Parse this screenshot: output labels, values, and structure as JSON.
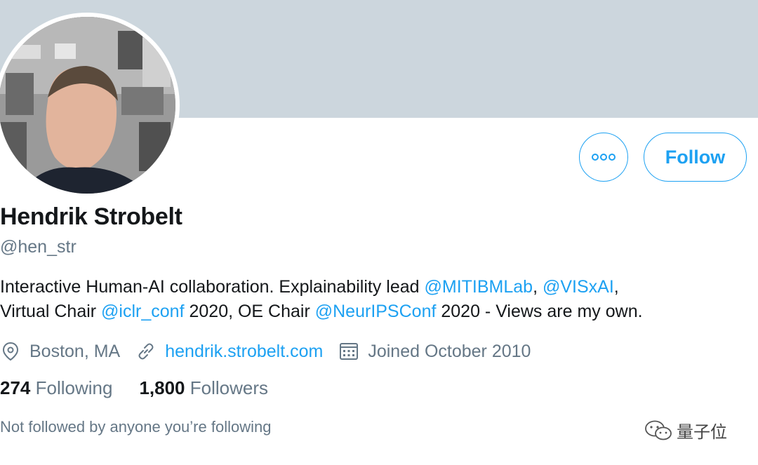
{
  "profile": {
    "name": "Hendrik Strobelt",
    "handle": "@hen_str",
    "bio": {
      "part1": "Interactive Human-AI collaboration. Explainability lead ",
      "mention1": "@MITIBMLab",
      "sep1": ", ",
      "mention2": "@VISxAI",
      "sep2": ",",
      "part2": "Virtual Chair ",
      "mention3": "@iclr_conf",
      "part3": " 2020, OE Chair ",
      "mention4": "@NeurIPSConf",
      "part4": " 2020 - Views are my own."
    },
    "location": "Boston, MA",
    "website": "hendrik.strobelt.com",
    "joined": "Joined October 2010",
    "following_count": "274",
    "following_label": "Following",
    "followers_count": "1,800",
    "followers_label": "Followers",
    "social_context": "Not followed by anyone you’re following"
  },
  "actions": {
    "follow_label": "Follow",
    "more_icon": "more-horizontal-icon"
  },
  "icons": {
    "location": "location-pin-icon",
    "website": "link-icon",
    "joined": "calendar-icon"
  },
  "watermark": {
    "text": "量子位"
  },
  "colors": {
    "accent": "#1da1f2",
    "banner": "#ccd6dd",
    "secondary_text": "#657786",
    "primary_text": "#14171a"
  }
}
